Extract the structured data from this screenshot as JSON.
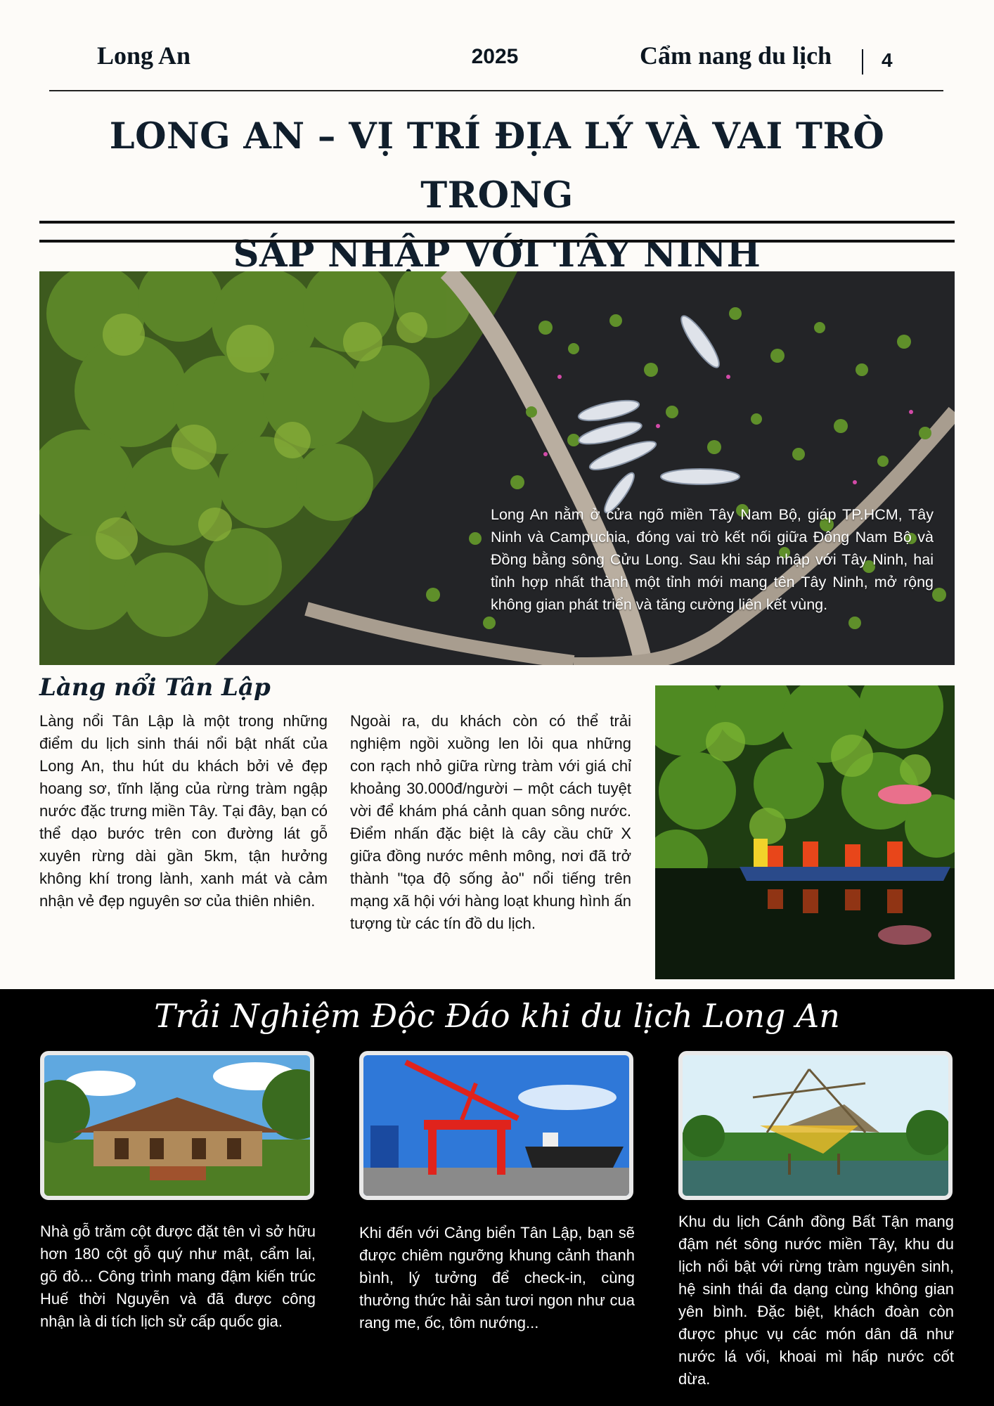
{
  "header": {
    "left": "Long An",
    "year": "2025",
    "right": "Cẩm nang du lịch",
    "page": "4"
  },
  "title": {
    "line1": "LONG AN – VỊ TRÍ ĐỊA LÝ VÀ VAI TRÒ TRONG",
    "line2": "SÁP NHẬP VỚI TÂY NINH"
  },
  "hero": {
    "text": "Long An nằm ở cửa ngõ miền Tây Nam Bộ, giáp TP.HCM, Tây Ninh và Campuchia, đóng vai trò kết nối giữa Đông Nam Bộ và Đồng bằng sông Cửu Long. Sau khi sáp nhập với Tây Ninh, hai tỉnh hợp nhất thành một tỉnh mới mang tên Tây Ninh, mở rộng không gian phát triển và tăng cường liên kết vùng."
  },
  "section": {
    "title": "Làng nổi Tân Lập",
    "col1": "Làng nổi Tân Lập là một trong những điểm du lịch sinh thái nổi bật nhất của Long An, thu hút du khách bởi vẻ đẹp hoang sơ, tĩnh lặng của rừng tràm ngập nước đặc trưng miền Tây. Tại đây, bạn có thể dạo bước trên con đường lát gỗ xuyên rừng dài gần 5km, tận hưởng không khí trong lành, xanh mát và cảm nhận vẻ đẹp nguyên sơ của thiên nhiên.",
    "col2": "Ngoài ra, du khách còn có thể trải nghiệm ngồi xuồng len lỏi qua những con rạch nhỏ giữa rừng tràm với giá chỉ khoảng 30.000đ/người – một cách tuyệt vời để khám phá cảnh quan sông nước. Điểm nhấn đặc biệt là cây cầu chữ X giữa đồng nước mênh mông, nơi đã trở thành \"tọa độ sống ảo\" nổi tiếng trên mạng xã hội với hàng loạt khung hình ấn tượng từ các tín đồ du lịch."
  },
  "experience": {
    "title": "Trải Nghiệm Độc Đáo khi du lịch Long An",
    "items": [
      {
        "caption": "Nhà gỗ trăm cột được đặt tên vì sở hữu hơn 180 cột gỗ quý như mật, cẩm lai, gõ đỏ... Công trình mang đậm kiến trúc Huế thời Nguyễn và đã được công nhận là di tích lịch sử cấp quốc gia."
      },
      {
        "caption": "Khi đến với Cảng biển Tân Lập, bạn sẽ được chiêm ngưỡng khung cảnh thanh bình, lý tưởng để check-in, cùng thưởng thức hải sản tươi ngon như cua rang me, ốc, tôm nướng..."
      },
      {
        "caption": "Khu du lịch Cánh đồng Bất Tận mang đậm nét sông nước miền Tây, khu du lịch nổi bật với rừng tràm nguyên sinh, hệ sinh thái đa dạng cùng không gian yên bình. Đặc biệt, khách đoàn còn được phục vụ các món dân dã như nước lá vối, khoai mì hấp nước cốt dừa."
      }
    ]
  }
}
